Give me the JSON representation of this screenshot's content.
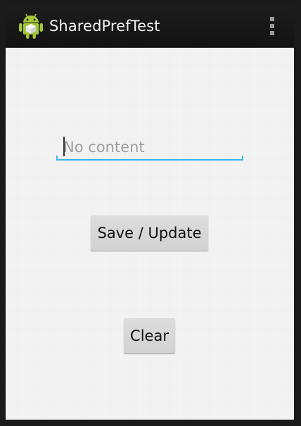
{
  "action_bar": {
    "icon": "android-robot-icon",
    "title": "SharedPrefTest",
    "overflow_icon": "overflow-menu-icon"
  },
  "main": {
    "text_field": {
      "value": "",
      "placeholder": "No content",
      "accent_color": "#33b5e5"
    },
    "save_button_label": "Save / Update",
    "clear_button_label": "Clear"
  }
}
